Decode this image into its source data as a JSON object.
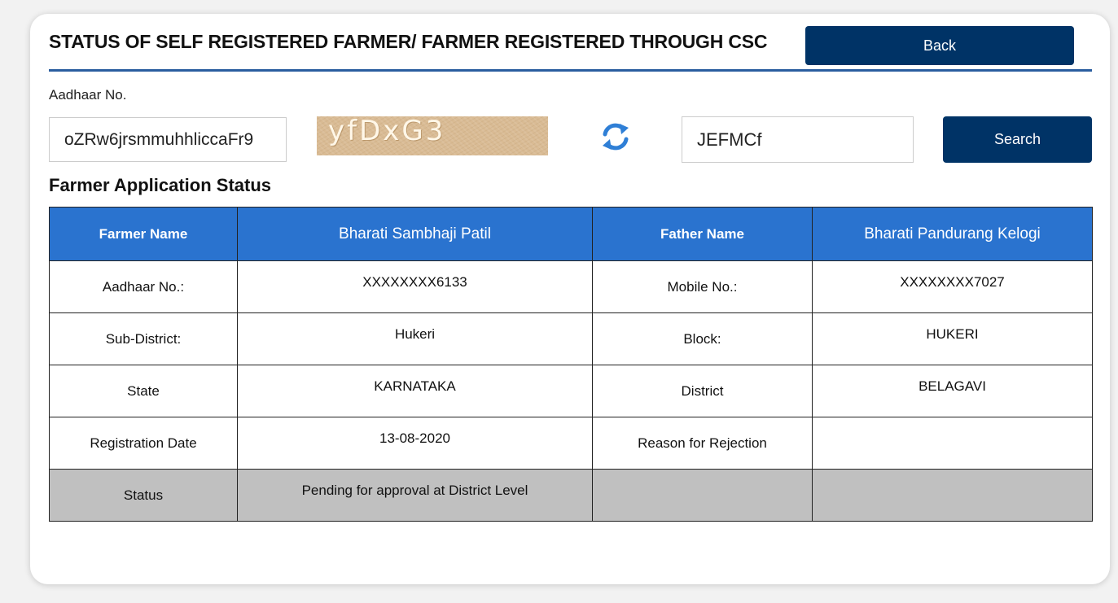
{
  "header": {
    "title": "STATUS OF SELF REGISTERED FARMER/ FARMER REGISTERED THROUGH CSC",
    "back_label": "Back"
  },
  "search": {
    "aadhaar_label": "Aadhaar No.",
    "aadhaar_value": "oZRw6jrsmmuhhliccaFr9",
    "captcha_image_text": "yfDxG3",
    "refresh_icon": "refresh-icon",
    "captcha_value": "JEFMCf",
    "search_label": "Search"
  },
  "section_title": "Farmer Application Status",
  "table": {
    "header": {
      "farmer_name_label": "Farmer Name",
      "farmer_name_value": "Bharati Sambhaji Patil",
      "father_name_label": "Father Name",
      "father_name_value": "Bharati Pandurang Kelogi"
    },
    "rows": [
      {
        "label1": "Aadhaar No.:",
        "value1": "XXXXXXXX6133",
        "label2": "Mobile No.:",
        "value2": "XXXXXXXX7027"
      },
      {
        "label1": "Sub-District:",
        "value1": "Hukeri",
        "label2": "Block:",
        "value2": "HUKERI"
      },
      {
        "label1": "State",
        "value1": "KARNATAKA",
        "label2": "District",
        "value2": "BELAGAVI"
      },
      {
        "label1": "Registration Date",
        "value1": "13-08-2020",
        "label2": "Reason for Rejection",
        "value2": ""
      },
      {
        "label1": "Status",
        "value1": "Pending for approval at District Level",
        "label2": "",
        "value2": ""
      }
    ]
  },
  "colors": {
    "primary_button": "#003366",
    "table_header": "#2a73cf",
    "status_row": "#c0c0c0",
    "header_rule": "#2a5d9f"
  }
}
